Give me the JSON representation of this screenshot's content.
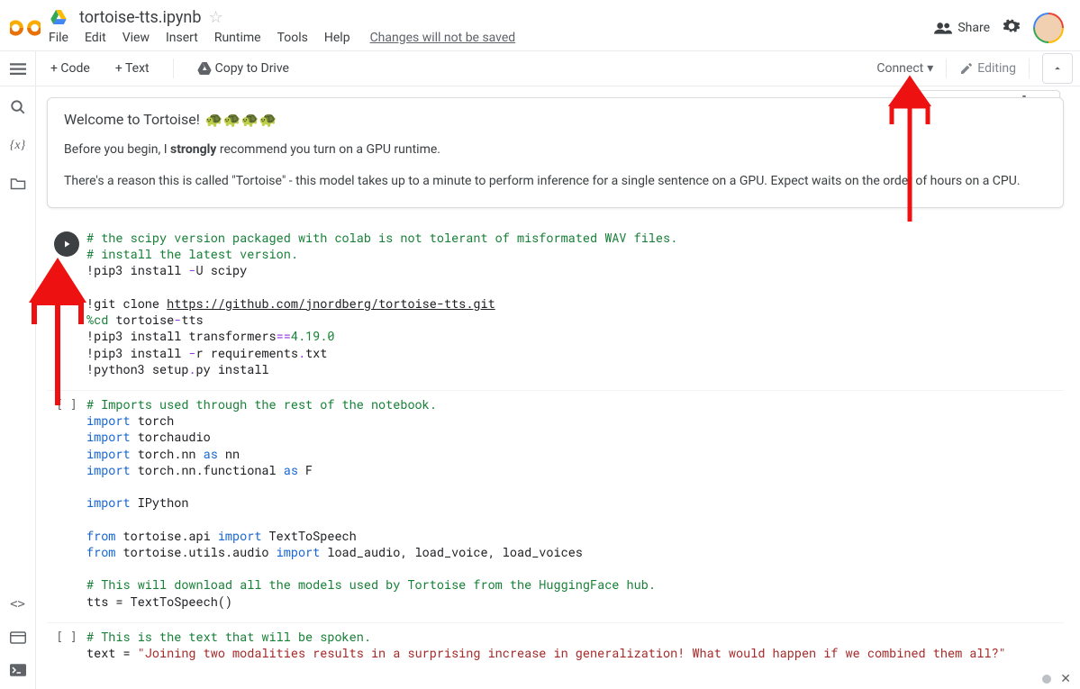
{
  "header": {
    "notebook_title": "tortoise-tts.ipynb",
    "menus": {
      "file": "File",
      "edit": "Edit",
      "view": "View",
      "insert": "Insert",
      "runtime": "Runtime",
      "tools": "Tools",
      "help": "Help"
    },
    "changes_msg": "Changes will not be saved",
    "share": "Share"
  },
  "toolbar": {
    "add_code": "+ Code",
    "add_text": "+ Text",
    "copy_drive": "Copy to Drive",
    "connect": "Connect",
    "editing": "Editing"
  },
  "text_cell": {
    "heading": "Welcome to Tortoise! ",
    "p1_a": "Before you begin, I ",
    "p1_strong": "strongly",
    "p1_b": " recommend you turn on a GPU runtime.",
    "p2": "There's a reason this is called \"Tortoise\" - this model takes up to a minute to perform inference for a single sentence on a GPU. Expect waits on the order of hours on a CPU."
  },
  "code1": {
    "l1": "# the scipy version packaged with colab is not tolerant of misformated WAV files.",
    "l2": "# install the latest version.",
    "l3a": "!pip3 install ",
    "l3b": "-",
    "l3c": "U scipy",
    "l4": "",
    "l5a": "!git clone ",
    "l5url": "https://github.com/jnordberg/tortoise-tts.git",
    "l6a": "%",
    "l6b": "cd",
    "l6c": " tortoise",
    "l6d": "-",
    "l6e": "tts",
    "l7a": "!pip3 install transformers",
    "l7b": "==",
    "l7c": "4.19.0",
    "l8a": "!pip3 install ",
    "l8b": "-",
    "l8c": "r requirements",
    "l8d": ".",
    "l8e": "txt",
    "l9a": "!python3 setup",
    "l9b": ".",
    "l9c": "py install"
  },
  "code2": {
    "l1": "# Imports used through the rest of the notebook.",
    "l2a": "import",
    "l2b": " torch",
    "l3a": "import",
    "l3b": " torchaudio",
    "l4a": "import",
    "l4b": " torch.nn ",
    "l4c": "as",
    "l4d": " nn",
    "l5a": "import",
    "l5b": " torch.nn.functional ",
    "l5c": "as",
    "l5d": " F",
    "l6": "",
    "l7a": "import",
    "l7b": " IPython",
    "l8": "",
    "l9a": "from",
    "l9b": " tortoise.api ",
    "l9c": "import",
    "l9d": " TextToSpeech",
    "l10a": "from",
    "l10b": " tortoise.utils.audio ",
    "l10c": "import",
    "l10d": " load_audio, load_voice, load_voices",
    "l11": "",
    "l12": "# This will download all the models used by Tortoise from the HuggingFace hub.",
    "l13": "tts = TextToSpeech()"
  },
  "code3": {
    "l1": "# This is the text that will be spoken.",
    "l2a": "text = ",
    "l2b": "\"Joining two modalities results in a surprising increase in generalization! What would happen if we combined them all?\""
  },
  "icons": {
    "toc": "toc-icon",
    "search": "search-icon",
    "vars": "vars-icon",
    "files": "files-icon",
    "code": "code-icon",
    "cmd": "cmd-icon",
    "term": "term-icon"
  }
}
